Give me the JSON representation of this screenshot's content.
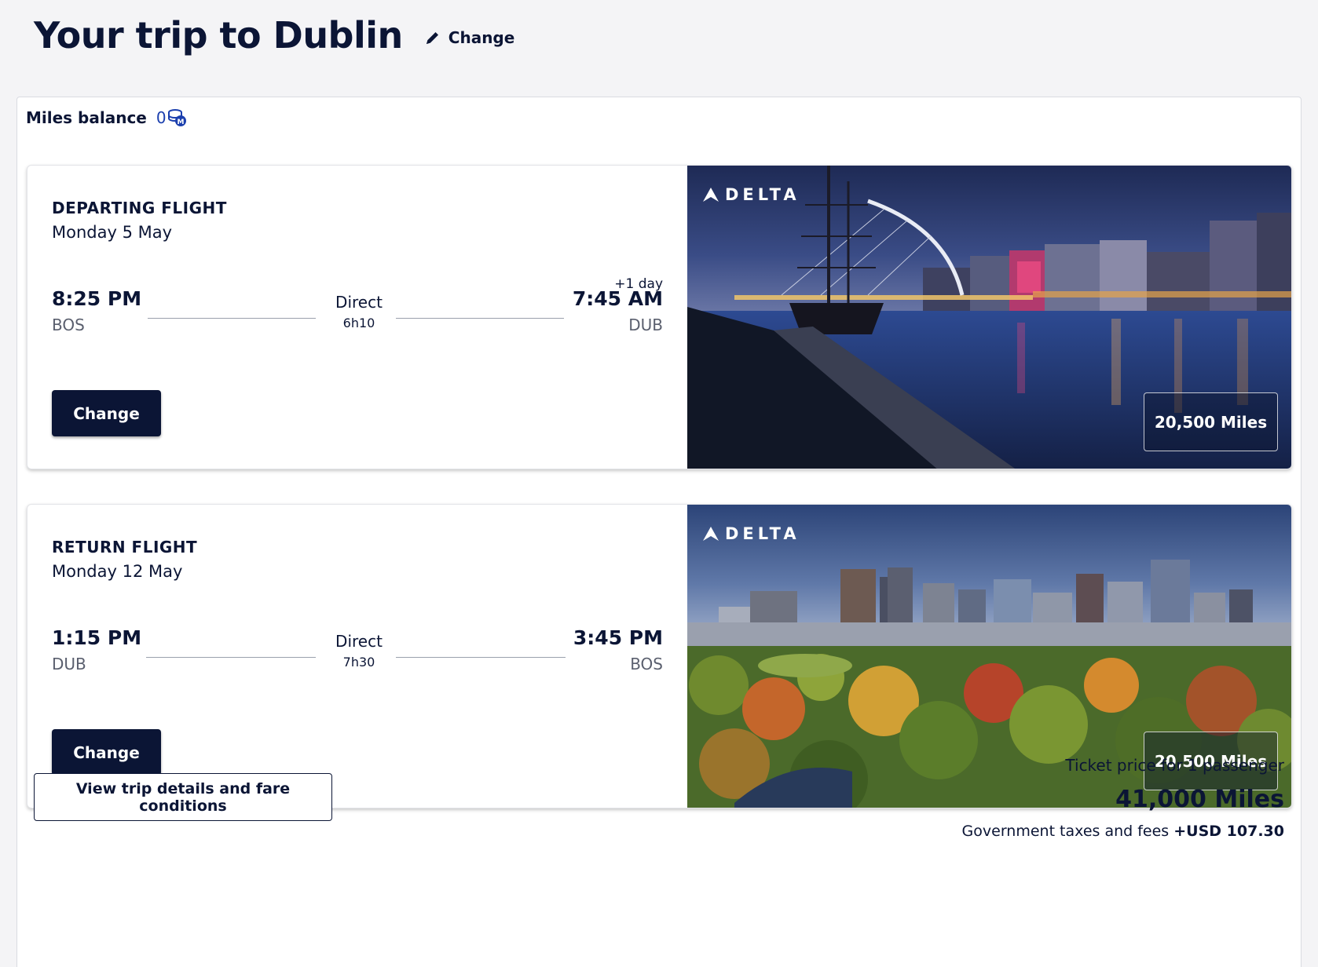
{
  "header": {
    "title": "Your trip to Dublin",
    "change_label": "Change"
  },
  "miles_balance": {
    "label": "Miles balance",
    "value": "0",
    "icon": "miles-coin-icon"
  },
  "flights": [
    {
      "type": "DEPARTING FLIGHT",
      "date": "Monday 5 May",
      "depart_time": "8:25 PM",
      "depart_code": "BOS",
      "arrive_time": "7:45 AM",
      "arrive_code": "DUB",
      "arrive_note": "+1 day",
      "stops": "Direct",
      "duration": "6h10",
      "change_label": "Change",
      "airline": "DELTA",
      "miles": "20,500 Miles"
    },
    {
      "type": "RETURN FLIGHT",
      "date": "Monday 12 May",
      "depart_time": "1:15 PM",
      "depart_code": "DUB",
      "arrive_time": "3:45 PM",
      "arrive_code": "BOS",
      "arrive_note": "",
      "stops": "Direct",
      "duration": "7h30",
      "change_label": "Change",
      "airline": "DELTA",
      "miles": "20,500 Miles"
    }
  ],
  "footer": {
    "details_label": "View trip details and fare conditions",
    "price_label": "Ticket price for 1 passenger",
    "total": "41,000 Miles",
    "taxes_label": "Government taxes and fees",
    "taxes_value": "+USD 107.30"
  },
  "colors": {
    "navy": "#0b1535",
    "background": "#f4f4f6",
    "accent_blue": "#1b3fae"
  }
}
